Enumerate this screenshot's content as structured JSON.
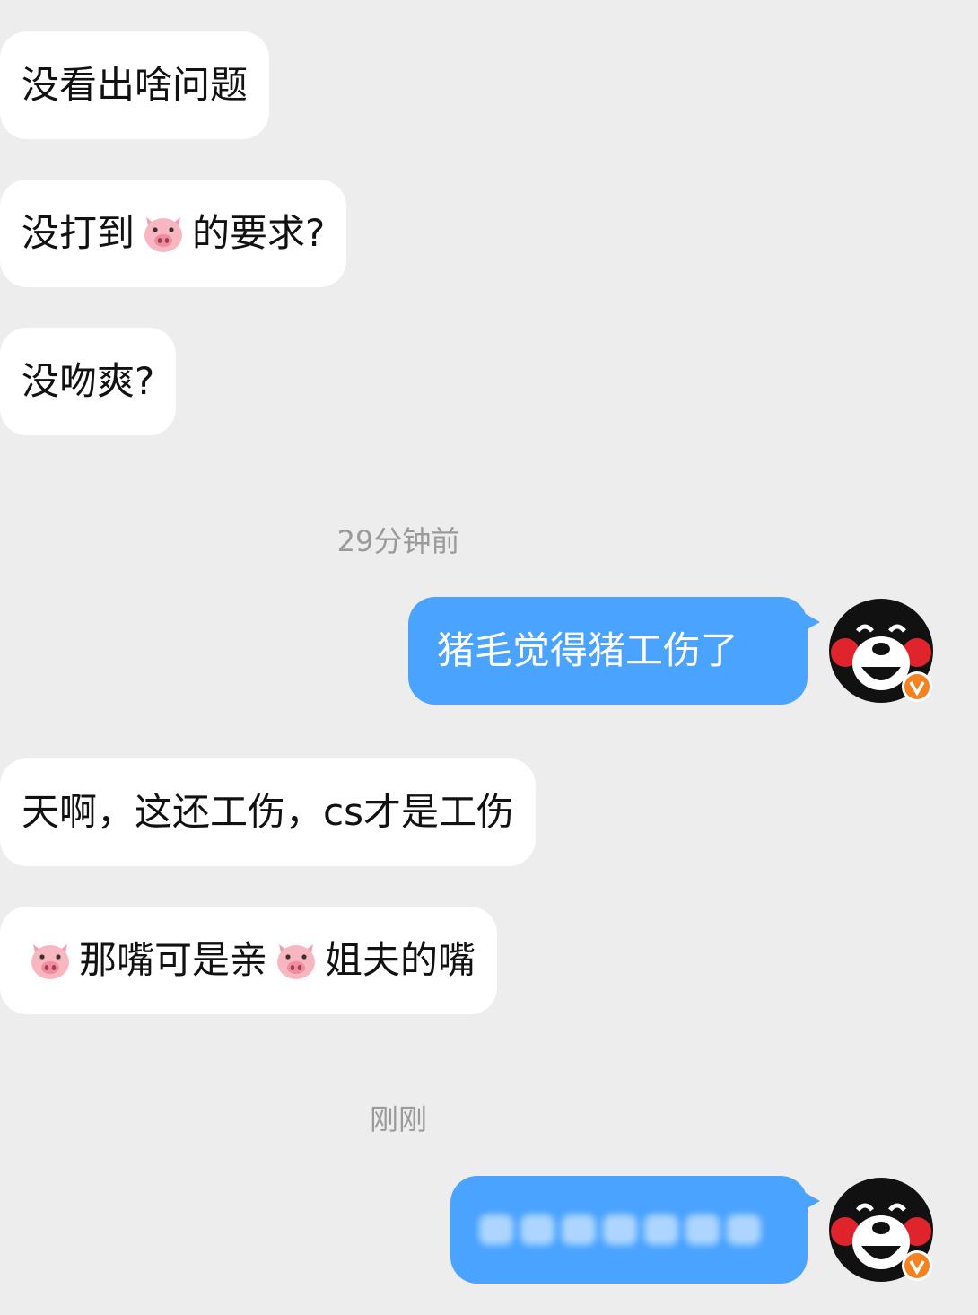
{
  "messages": [
    {
      "side": "in",
      "text": "没看出啥问题"
    },
    {
      "side": "in",
      "before": "没打到",
      "after": "的要求?"
    },
    {
      "side": "in",
      "text": "没吻爽?"
    },
    {
      "side": "time",
      "text": "29分钟前"
    },
    {
      "side": "out",
      "text": "猪毛觉得猪工伤了"
    },
    {
      "side": "in",
      "text": "天啊，这还工伤，cs才是工伤"
    },
    {
      "side": "in",
      "mid": "那嘴可是亲",
      "end": "姐夫的嘴"
    },
    {
      "side": "time",
      "text": "刚刚"
    }
  ],
  "colors": {
    "background": "#ededed",
    "incoming_bubble": "#ffffff",
    "outgoing_bubble": "#4aa3ff",
    "timestamp": "#9a9a9a",
    "verified_badge": "#f58220"
  },
  "icons": {
    "pig": "pig-face-emoji",
    "avatar": "kumamon-avatar",
    "badge": "verified-v-badge"
  }
}
